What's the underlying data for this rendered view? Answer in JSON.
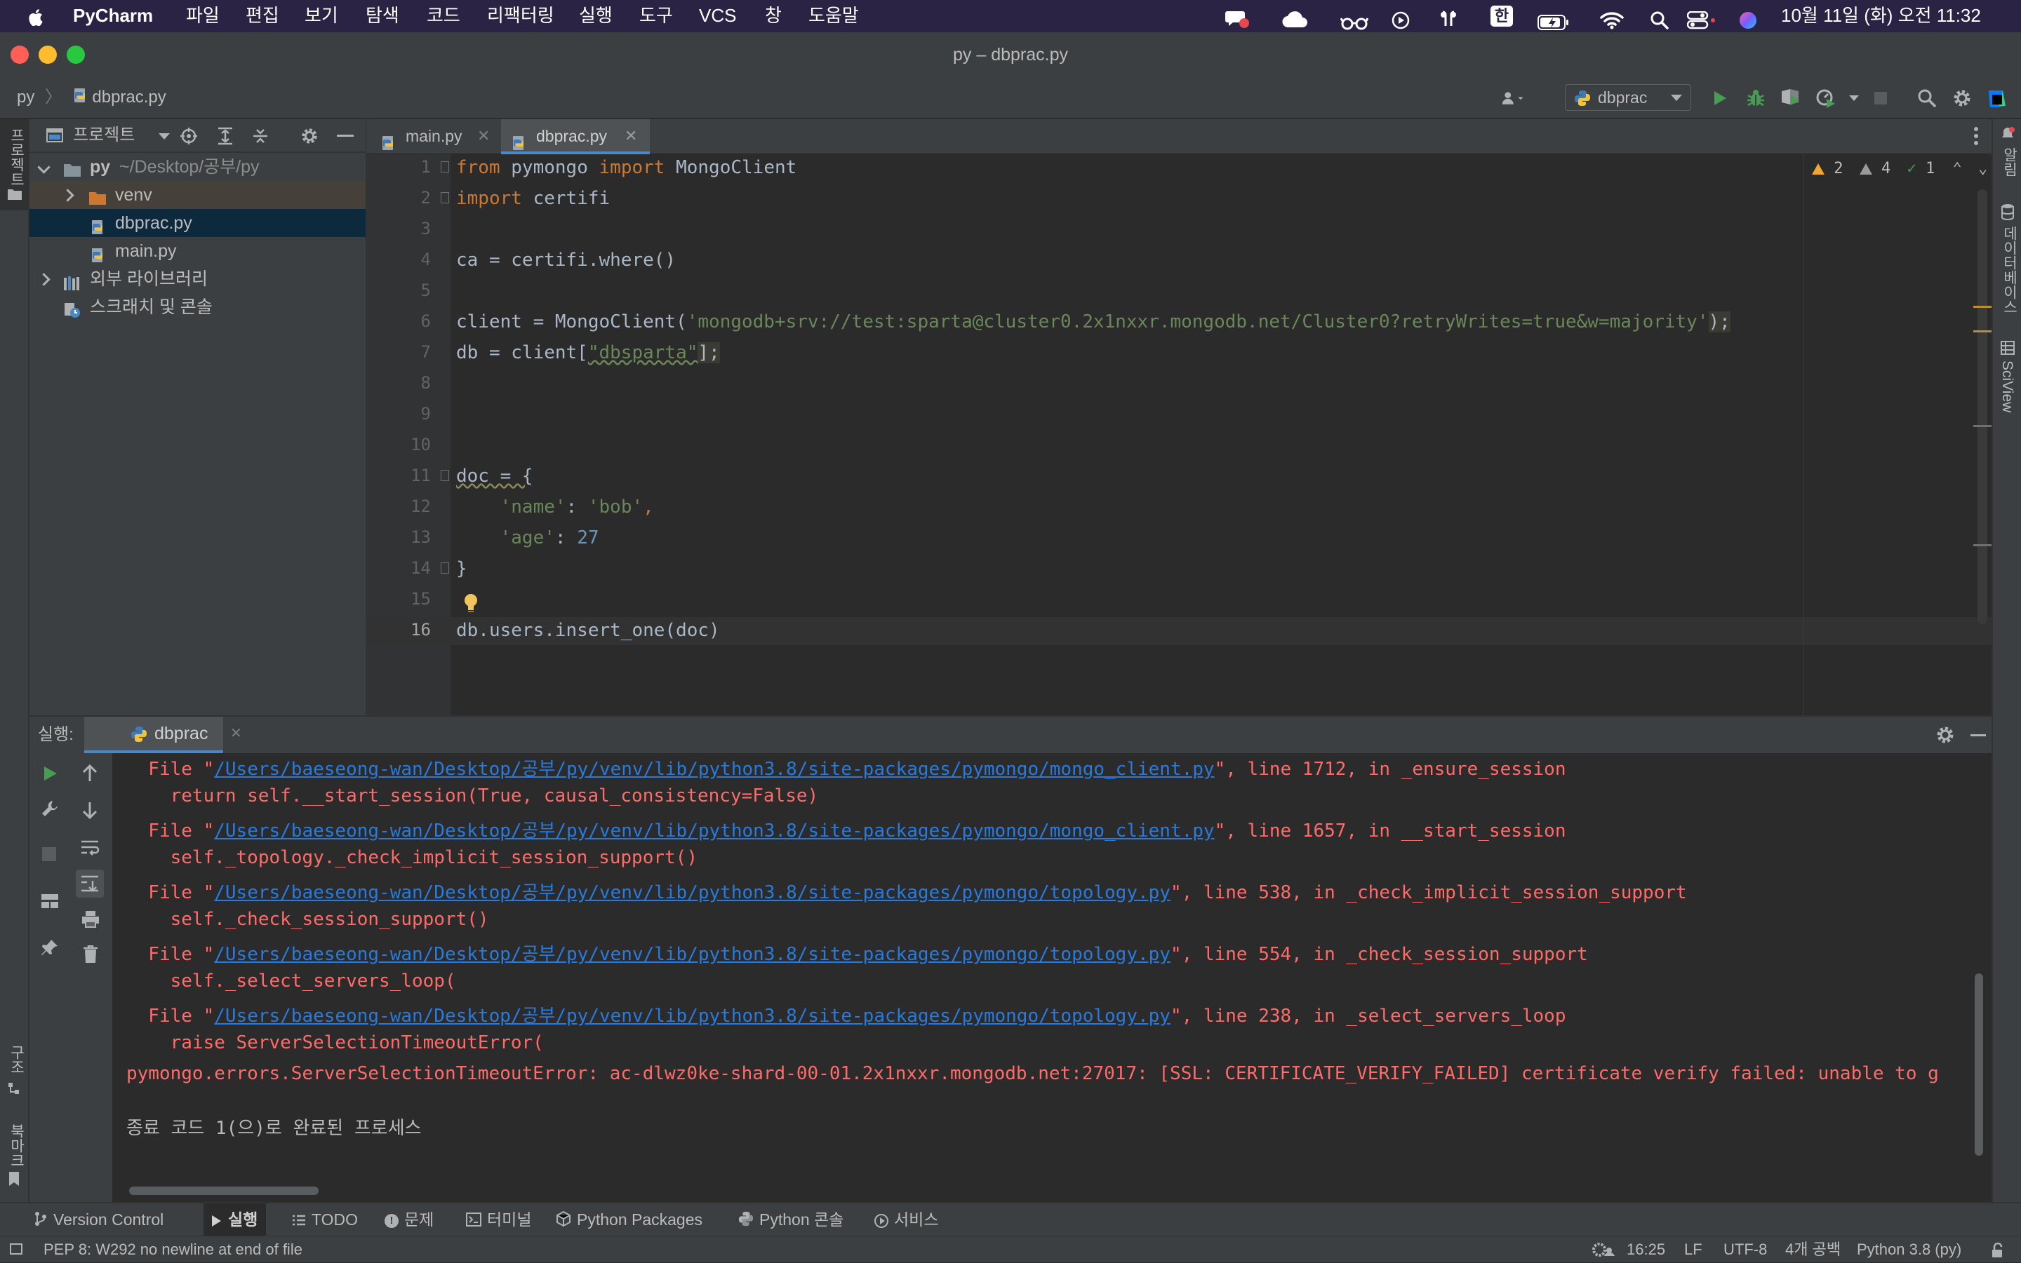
{
  "menubar": {
    "app_name": "PyCharm",
    "menus": [
      "파일",
      "편집",
      "보기",
      "탐색",
      "코드",
      "리팩터링",
      "실행",
      "도구",
      "VCS",
      "창",
      "도움말"
    ],
    "input_source": "한",
    "clock": "10월 11일 (화) 오전 11:32"
  },
  "window": {
    "title": "py – dbprac.py"
  },
  "navbar": {
    "breadcrumb_root": "py",
    "breadcrumb_file": "dbprac.py",
    "run_config": "dbprac"
  },
  "left_stripe": {
    "project_label": "프로젝트",
    "structure_label": "구조",
    "bookmarks_label": "북마크"
  },
  "right_stripe": {
    "notifications_label": "알림",
    "database_label": "데이터베이스",
    "sciview_label": "SciView"
  },
  "project": {
    "header_label": "프로젝트",
    "root_name": "py",
    "root_path": "~/Desktop/공부/py",
    "items": [
      "venv",
      "dbprac.py",
      "main.py"
    ],
    "external_libraries": "외부 라이브러리",
    "scratches": "스크래치 및 콘솔"
  },
  "tabs": [
    "main.py",
    "dbprac.py"
  ],
  "inspections": {
    "warnings": "2",
    "weak_warnings": "4",
    "typos": "1"
  },
  "editor": {
    "line_numbers": [
      "1",
      "2",
      "3",
      "4",
      "5",
      "6",
      "7",
      "8",
      "9",
      "10",
      "11",
      "12",
      "13",
      "14",
      "15",
      "16"
    ],
    "lines": {
      "l1_kw1": "from",
      "l1_a": " pymongo ",
      "l1_kw2": "import",
      "l1_b": " MongoClient",
      "l2_kw": "import",
      "l2_a": " certifi",
      "l4": "ca = certifi.where()",
      "l6_a": "client = MongoClient(",
      "l6_str": "'mongodb+srv://test:sparta@cluster0.2x1nxxr.mongodb.net/Cluster0?retryWrites=true&w=majority'",
      "l6_b": ");",
      "l7_a": "db = client[",
      "l7_str": "\"dbsparta\"",
      "l7_b": "];",
      "l11": "doc = {",
      "l12_str1": "'name'",
      "l12_a": ": ",
      "l12_str2": "'bob'",
      "l12_b": ",",
      "l13_str": "'age'",
      "l13_a": ": ",
      "l13_num": "27",
      "l14": "}",
      "l16": "db.users.insert_one(doc)"
    }
  },
  "run": {
    "label": "실행:",
    "tab": "dbprac",
    "output": [
      {
        "type": "file",
        "pre": "  File \"",
        "link": "/Users/baeseong-wan/Desktop/공부/py/venv/lib/python3.8/site-packages/pymongo/mongo_client.py",
        "post": "\", line 1712, in _ensure_session"
      },
      {
        "type": "text",
        "text": "    return self.__start_session(True, causal_consistency=False)"
      },
      {
        "type": "file",
        "pre": "  File \"",
        "link": "/Users/baeseong-wan/Desktop/공부/py/venv/lib/python3.8/site-packages/pymongo/mongo_client.py",
        "post": "\", line 1657, in __start_session"
      },
      {
        "type": "text",
        "text": "    self._topology._check_implicit_session_support()"
      },
      {
        "type": "file",
        "pre": "  File \"",
        "link": "/Users/baeseong-wan/Desktop/공부/py/venv/lib/python3.8/site-packages/pymongo/topology.py",
        "post": "\", line 538, in _check_implicit_session_support"
      },
      {
        "type": "text",
        "text": "    self._check_session_support()"
      },
      {
        "type": "file",
        "pre": "  File \"",
        "link": "/Users/baeseong-wan/Desktop/공부/py/venv/lib/python3.8/site-packages/pymongo/topology.py",
        "post": "\", line 554, in _check_session_support"
      },
      {
        "type": "text",
        "text": "    self._select_servers_loop("
      },
      {
        "type": "file",
        "pre": "  File \"",
        "link": "/Users/baeseong-wan/Desktop/공부/py/venv/lib/python3.8/site-packages/pymongo/topology.py",
        "post": "\", line 238, in _select_servers_loop"
      },
      {
        "type": "text",
        "text": "    raise ServerSelectionTimeoutError("
      },
      {
        "type": "text",
        "text": "pymongo.errors.ServerSelectionTimeoutError: ac-dlwz0ke-shard-00-01.2x1nxxr.mongodb.net:27017: [SSL: CERTIFICATE_VERIFY_FAILED] certificate verify failed: unable to g"
      },
      {
        "type": "exit",
        "text": "종료 코드 1(으)로 완료된 프로세스"
      }
    ]
  },
  "tool_windows": [
    "Version Control",
    "실행",
    "TODO",
    "문제",
    "터미널",
    "Python Packages",
    "Python 콘솔",
    "서비스"
  ],
  "status": {
    "message": "PEP 8: W292 no newline at end of file",
    "position": "16:25",
    "line_sep": "LF",
    "encoding": "UTF-8",
    "indent": "4개 공백",
    "interpreter": "Python 3.8 (py)"
  },
  "colors": {
    "keyword": "#cc7832",
    "string": "#6a8759",
    "number": "#6897bb",
    "error_text": "#ff6b68",
    "link": "#287bde",
    "run_green": "#499c54"
  }
}
